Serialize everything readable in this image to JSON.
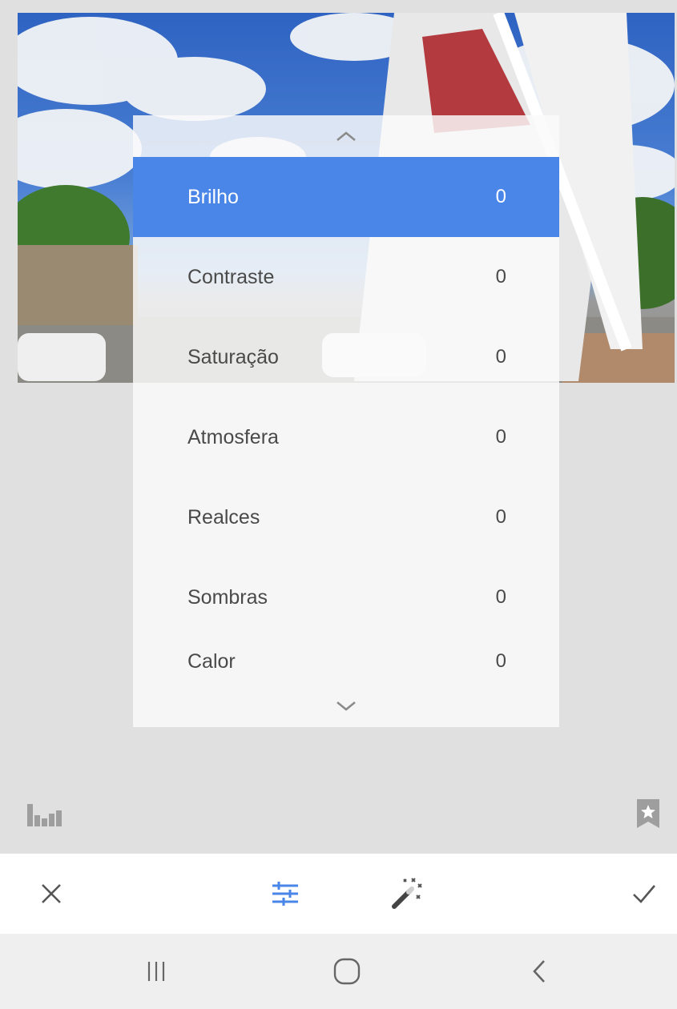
{
  "adjustments": {
    "items": [
      {
        "label": "Brilho",
        "value": "0",
        "active": true
      },
      {
        "label": "Contraste",
        "value": "0",
        "active": false
      },
      {
        "label": "Saturação",
        "value": "0",
        "active": false
      },
      {
        "label": "Atmosfera",
        "value": "0",
        "active": false
      },
      {
        "label": "Realces",
        "value": "0",
        "active": false
      },
      {
        "label": "Sombras",
        "value": "0",
        "active": false
      },
      {
        "label": "Calor",
        "value": "0",
        "active": false
      }
    ]
  },
  "icons": {
    "scroll_up": "chevron-up-icon",
    "scroll_down": "chevron-down-icon",
    "histogram": "histogram-icon",
    "styles": "bookmark-star-icon",
    "cancel": "close-icon",
    "tune": "tune-sliders-icon",
    "auto": "magic-wand-icon",
    "apply": "check-icon",
    "nav_recents": "recent-apps-icon",
    "nav_home": "home-icon",
    "nav_back": "back-icon"
  },
  "colors": {
    "accent": "#4a86e8",
    "background": "#e0e0e0",
    "text": "#4a4a4a"
  }
}
